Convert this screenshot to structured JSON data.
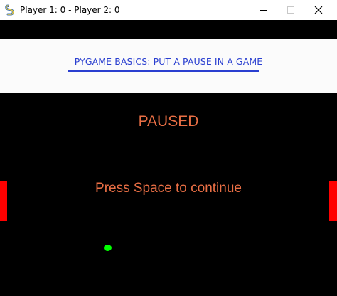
{
  "window": {
    "title": "Player 1: 0 - Player 2: 0",
    "icon": "pygame-snake-icon",
    "controls": {
      "minimize_icon": "minimize-icon",
      "maximize_icon": "maximize-icon",
      "close_icon": "close-icon",
      "maximize_enabled": false
    }
  },
  "banner": {
    "title": "PYGAME BASICS: PUT A PAUSE IN A GAME"
  },
  "game": {
    "score": {
      "player1": 0,
      "player2": 0
    },
    "state": "paused",
    "pause_title": "PAUSED",
    "pause_hint": "Press Space to continue",
    "paddles": [
      "left",
      "right"
    ],
    "ball": "ball"
  },
  "colors": {
    "background": "#000000",
    "banner_background": "#fbfbfb",
    "banner_text": "#2a3fd0",
    "pause_text": "#ea6f45",
    "paddle": "#ff0000",
    "ball": "#00ff00",
    "titlebar": "#ffffff"
  }
}
